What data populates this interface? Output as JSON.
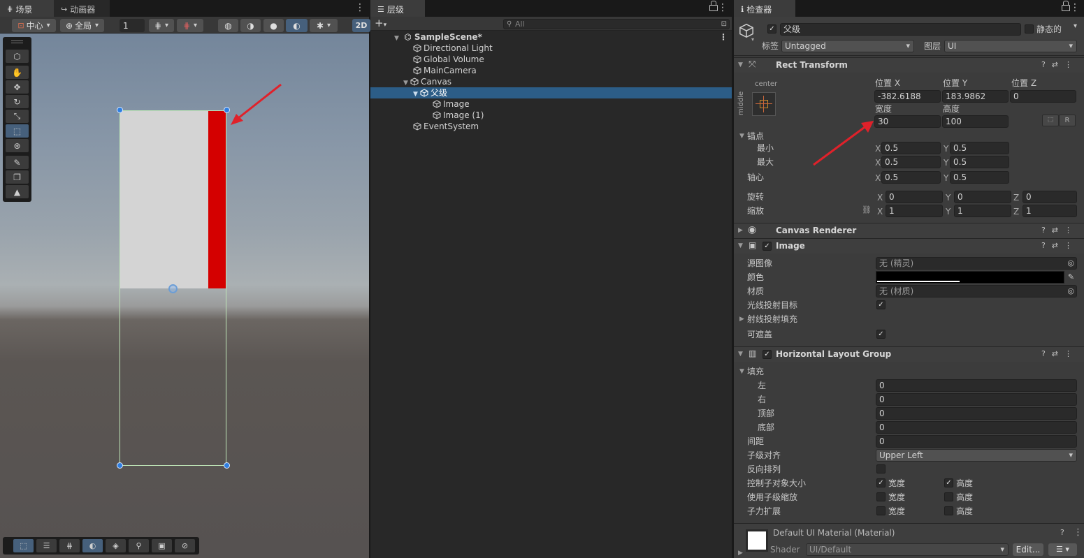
{
  "scene_panel": {
    "tabs": [
      {
        "label": "场景"
      },
      {
        "label": "动画器"
      }
    ],
    "toolbar": {
      "pivot": "中心",
      "space": "全局",
      "snap_value": "1",
      "mode_2d": "2D"
    },
    "scene_objects": {
      "canvas_rect_color": "#d4d4d4",
      "image_red_color": "#d40000"
    }
  },
  "hierarchy_panel": {
    "tab_label": "层级",
    "search_placeholder": "All",
    "add_label": "+",
    "rows": [
      {
        "label": "SampleScene*",
        "expanded": true,
        "selected": false
      },
      {
        "label": "Directional Light",
        "selected": false
      },
      {
        "label": "Global Volume",
        "selected": false
      },
      {
        "label": "MainCamera",
        "selected": false
      },
      {
        "label": "Canvas",
        "expanded": true,
        "selected": false
      },
      {
        "label": "父级",
        "expanded": true,
        "selected": true
      },
      {
        "label": "Image",
        "selected": false
      },
      {
        "label": "Image (1)",
        "selected": false
      },
      {
        "label": "EventSystem",
        "selected": false
      }
    ]
  },
  "inspector_panel": {
    "tab_label": "检查器",
    "object": {
      "name": "父级",
      "active": true,
      "static_label": "静态的",
      "tag_label": "标签",
      "tag_value": "Untagged",
      "layer_label": "图层",
      "layer_value": "UI"
    },
    "rect_transform": {
      "title": "Rect Transform",
      "anchor_preset_h": "center",
      "anchor_preset_v": "middle",
      "pos_x_label": "位置 X",
      "pos_y_label": "位置 Y",
      "pos_z_label": "位置 Z",
      "pos_x": "-382.6188",
      "pos_y": "183.9862",
      "pos_z": "0",
      "width_label": "宽度",
      "height_label": "高度",
      "width": "30",
      "height": "100",
      "r_button": "R",
      "anchors_label": "锚点",
      "min_label": "最小",
      "max_label": "最大",
      "min_x": "0.5",
      "min_y": "0.5",
      "max_x": "0.5",
      "max_y": "0.5",
      "pivot_label": "轴心",
      "pivot_x": "0.5",
      "pivot_y": "0.5",
      "rotation_label": "旋转",
      "rot_x": "0",
      "rot_y": "0",
      "rot_z": "0",
      "scale_label": "缩放",
      "scale_x": "1",
      "scale_y": "1",
      "scale_z": "1",
      "axis_x": "X",
      "axis_y": "Y",
      "axis_z": "Z"
    },
    "canvas_renderer": {
      "title": "Canvas Renderer"
    },
    "image": {
      "title": "Image",
      "enabled": true,
      "source_label": "源图像",
      "source_value": "无 (精灵)",
      "color_label": "颜色",
      "color_value": "#000000",
      "material_label": "材质",
      "material_value": "无 (材质)",
      "raycast_target_label": "光线投射目标",
      "raycast_target": true,
      "raycast_padding_label": "射线投射填充",
      "maskable_label": "可遮盖",
      "maskable": true
    },
    "horizontal_layout": {
      "title": "Horizontal Layout Group",
      "enabled": true,
      "padding_label": "填充",
      "left_label": "左",
      "left": "0",
      "right_label": "右",
      "right": "0",
      "top_label": "顶部",
      "top": "0",
      "bottom_label": "底部",
      "bottom": "0",
      "spacing_label": "间距",
      "spacing": "0",
      "child_alignment_label": "子级对齐",
      "child_alignment": "Upper Left",
      "reverse_label": "反向排列",
      "reverse": false,
      "control_size_label": "控制子对象大小",
      "control_width": true,
      "control_height": true,
      "use_scale_label": "使用子级缩放",
      "scale_width": false,
      "scale_height": false,
      "expand_label": "子力扩展",
      "expand_width": false,
      "expand_height": false,
      "width_word": "宽度",
      "height_word": "高度"
    },
    "material": {
      "title": "Default UI Material (Material)",
      "shader_label": "Shader",
      "shader_value": "UI/Default",
      "edit_button": "Edit..."
    }
  },
  "annotation_color": "#e0212a"
}
